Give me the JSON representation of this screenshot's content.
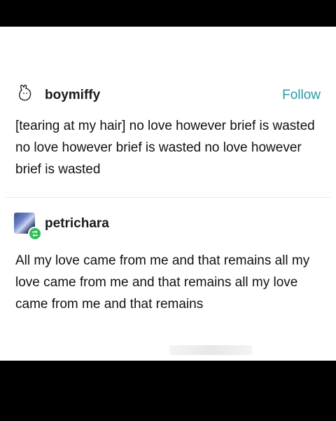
{
  "post1": {
    "username": "boymiffy",
    "follow_label": "Follow",
    "avatar_icon": "bunny-outline-icon",
    "text": "[tearing at my hair] no love however brief is wasted no love however brief is wasted no love however brief is wasted"
  },
  "post2": {
    "username": "petrichara",
    "avatar_icon": "avatar-image",
    "badge_icon": "reblog-icon",
    "text": "All my love came from me and that remains all my love came from me and that remains all my love came from me and that remains"
  },
  "colors": {
    "follow": "#2b9aa8",
    "badge": "#2fbf5a"
  }
}
